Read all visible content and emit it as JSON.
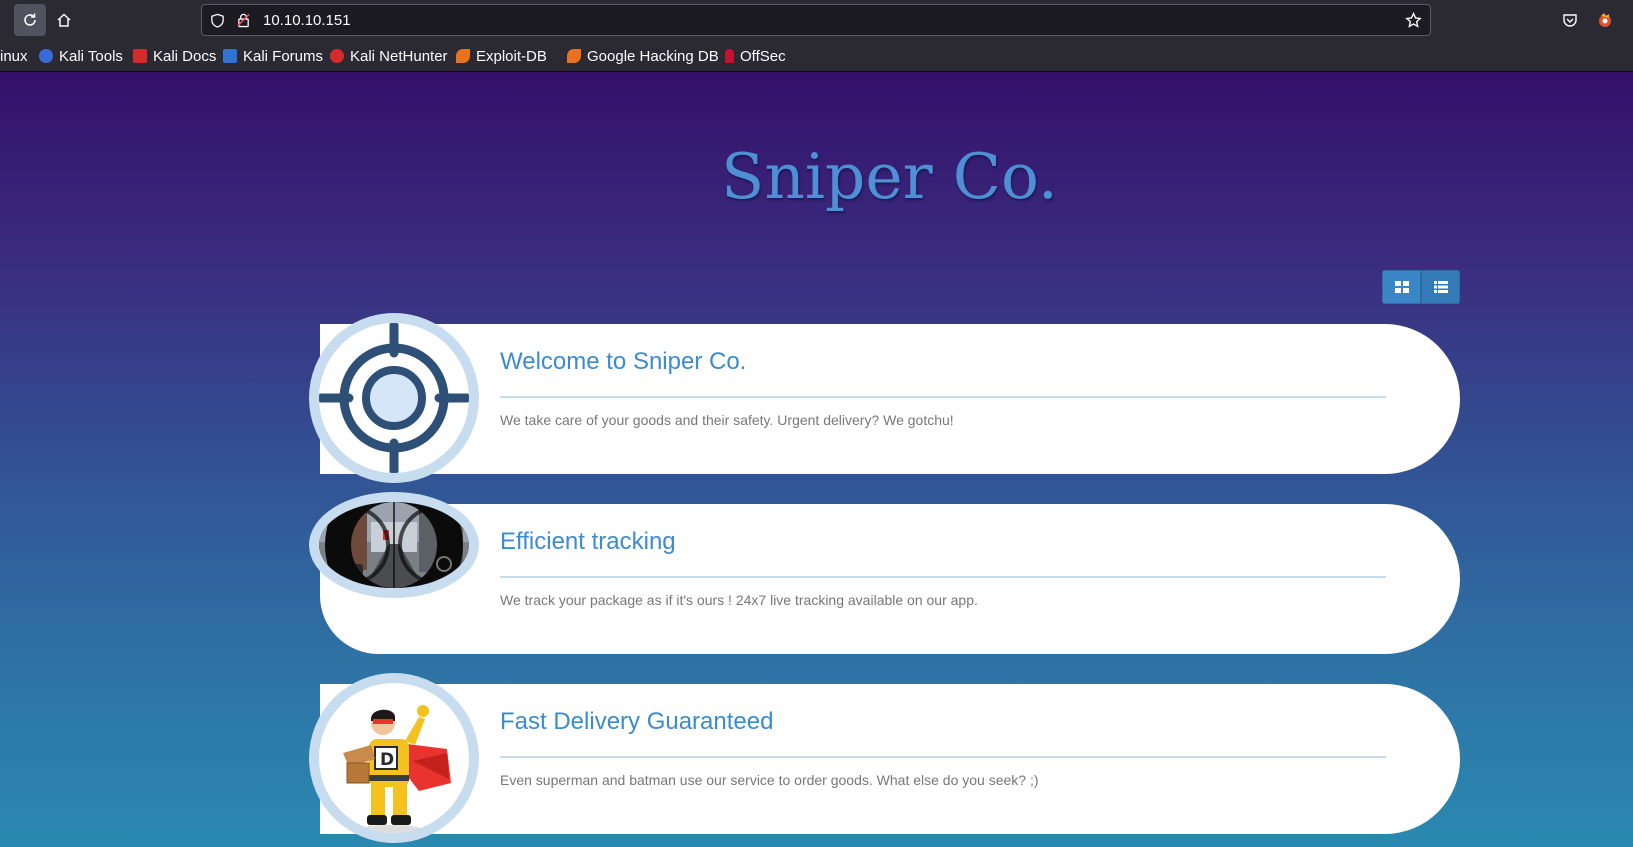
{
  "browser": {
    "url": "10.10.10.151",
    "bookmarks": [
      {
        "label": "inux",
        "icon": "kali-linux-icon"
      },
      {
        "label": "Kali Tools",
        "icon": "kali-tools-icon"
      },
      {
        "label": "Kali Docs",
        "icon": "kali-docs-icon"
      },
      {
        "label": "Kali Forums",
        "icon": "kali-forums-icon"
      },
      {
        "label": "Kali NetHunter",
        "icon": "kali-nethunter-icon"
      },
      {
        "label": "Exploit-DB",
        "icon": "exploit-db-icon"
      },
      {
        "label": "Google Hacking DB",
        "icon": "ghdb-icon"
      },
      {
        "label": "OffSec",
        "icon": "offsec-icon"
      }
    ]
  },
  "site": {
    "title": "Sniper Co.",
    "accent_color": "#3b8bd2",
    "cards": [
      {
        "title": "Welcome to Sniper Co.",
        "text": "We take care of your goods and their safety. Urgent delivery? We gotchu!",
        "image": "crosshair-icon"
      },
      {
        "title": "Efficient tracking",
        "text": "We track your package as if it's ours ! 24x7 live tracking available on our app.",
        "image": "scope-view-image"
      },
      {
        "title": "Fast Delivery Guaranteed",
        "text": "Even superman and batman use our service to order goods. What else do you seek? ;)",
        "image": "delivery-hero-image"
      }
    ]
  }
}
